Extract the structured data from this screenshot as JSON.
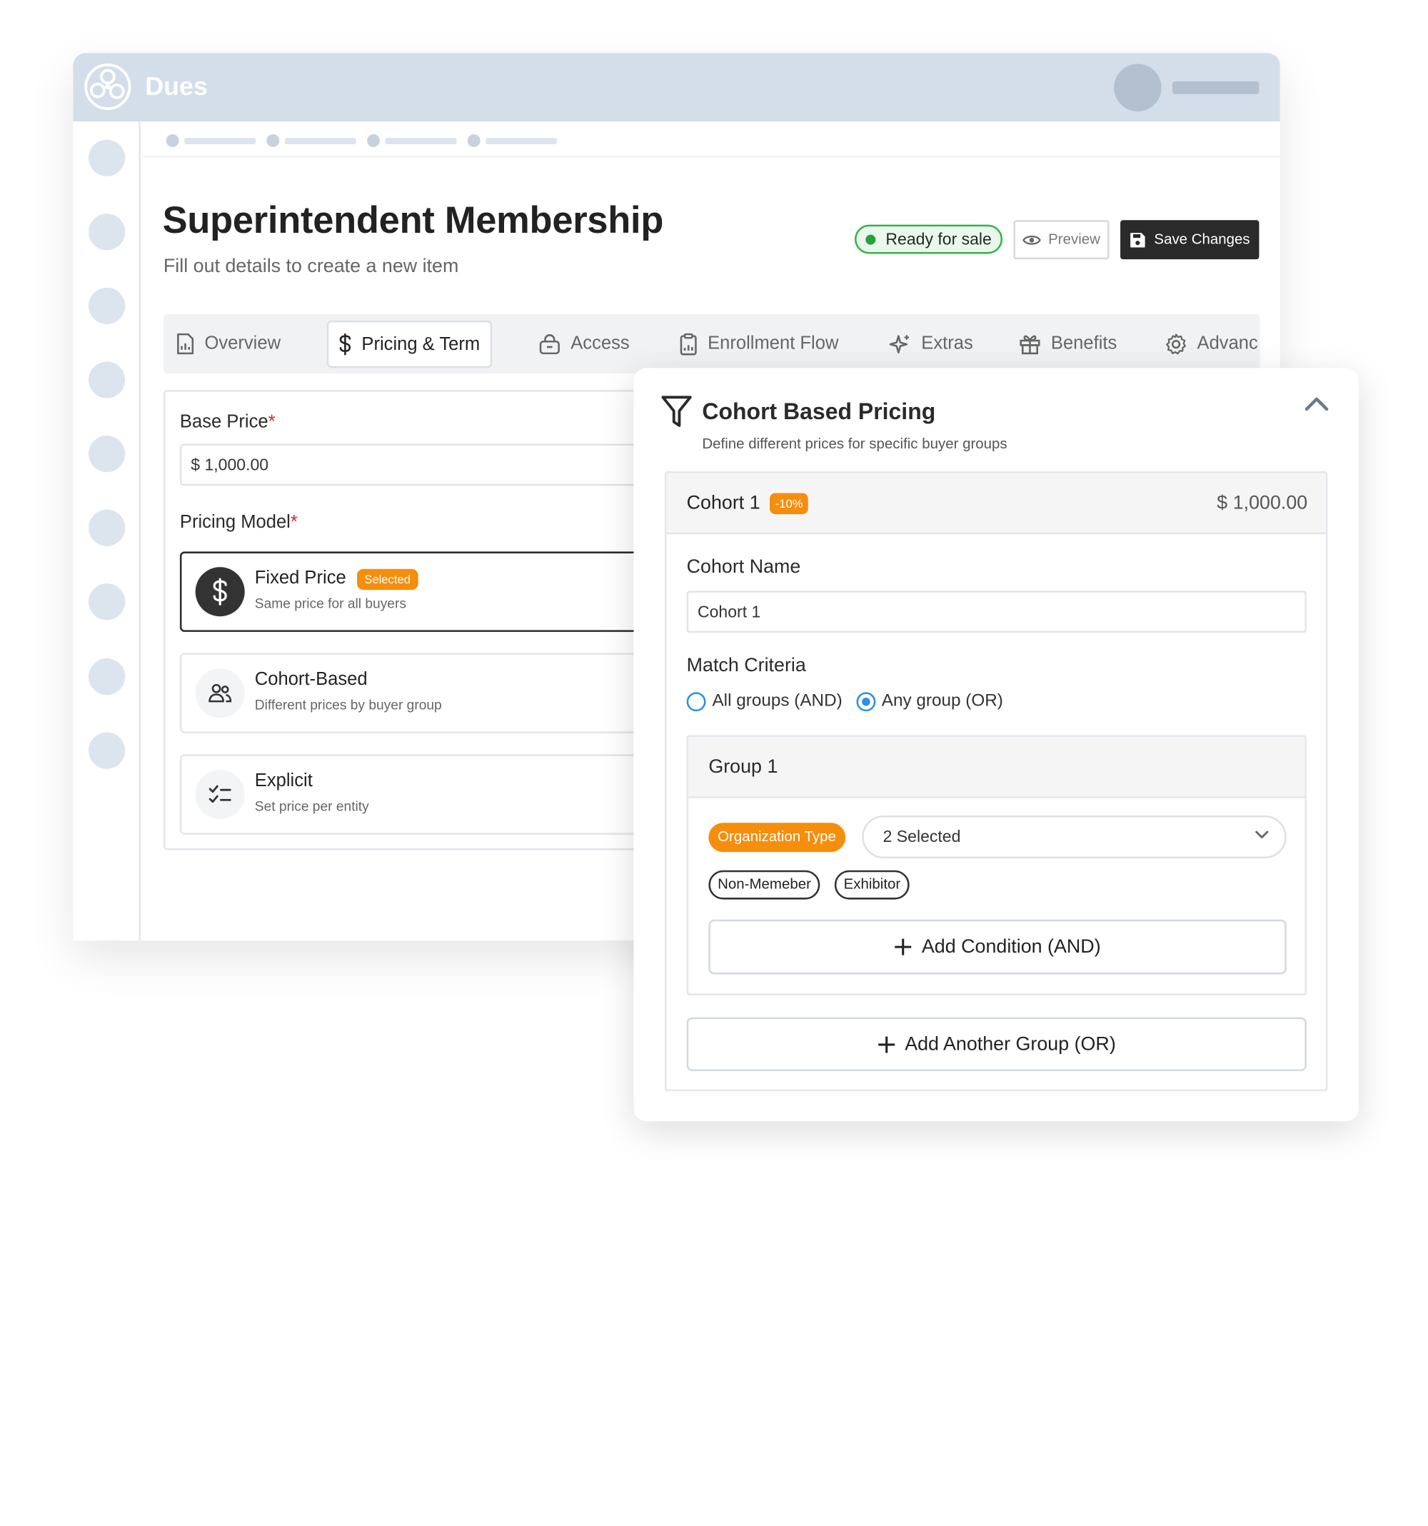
{
  "app": {
    "brand": "Dues"
  },
  "header": {
    "title": "Superintendent Membership",
    "subtitle": "Fill out details to create a new item",
    "status_badge": "Ready for sale",
    "preview_label": "Preview",
    "save_label": "Save Changes"
  },
  "tabs": [
    {
      "label": "Overview",
      "icon": "report-icon",
      "active": false
    },
    {
      "label": "Pricing & Term",
      "icon": "dollar-icon",
      "active": true
    },
    {
      "label": "Access",
      "icon": "lock-icon",
      "active": false
    },
    {
      "label": "Enrollment Flow",
      "icon": "clipboard-icon",
      "active": false
    },
    {
      "label": "Extras",
      "icon": "sparkle-icon",
      "active": false
    },
    {
      "label": "Benefits",
      "icon": "gift-icon",
      "active": false
    },
    {
      "label": "Advanc",
      "icon": "gear-icon",
      "active": false
    }
  ],
  "form": {
    "base_price_label": "Base Price",
    "required_mark": "*",
    "base_price_value": "$ 1,000.00",
    "pricing_model_label": "Pricing Model",
    "options": [
      {
        "title": "Fixed Price",
        "subtitle": "Same price for all buyers",
        "badge": "Selected",
        "icon": "dollar-icon",
        "selected": true
      },
      {
        "title": "Cohort-Based",
        "subtitle": "Different prices by buyer group",
        "icon": "users-icon",
        "selected": false
      },
      {
        "title": "Explicit",
        "subtitle": "Set price per entity",
        "icon": "checklist-icon",
        "selected": false
      }
    ]
  },
  "panel": {
    "title": "Cohort Based Pricing",
    "subtitle": "Define different prices for specific buyer groups",
    "cohort": {
      "name": "Cohort 1",
      "discount": "-10%",
      "price": "$ 1,000.00",
      "name_label": "Cohort Name",
      "name_value": "Cohort 1",
      "match_label": "Match Criteria",
      "match_options": [
        "All groups (AND)",
        "Any group (OR)"
      ],
      "match_selected": "Any group (OR)"
    },
    "group": {
      "title": "Group 1",
      "condition_tag": "Organization Type",
      "dropdown_value": "2 Selected",
      "chips": [
        "Non-Memeber",
        "Exhibitor"
      ],
      "add_condition_label": "Add Condition (AND)"
    },
    "add_group_label": "Add Another Group (OR)"
  },
  "colors": {
    "accent_orange": "#f58e0c",
    "ready_green": "#24a33b",
    "radio_blue": "#2f8fe3",
    "topbar": "#d3deea"
  }
}
